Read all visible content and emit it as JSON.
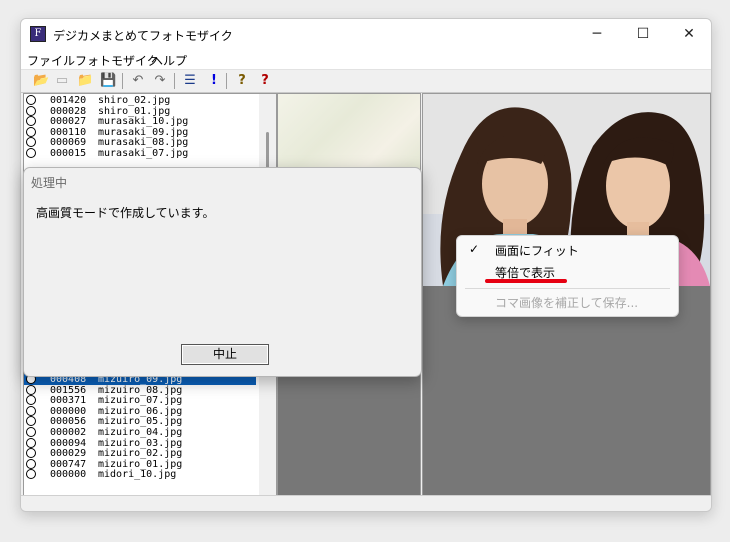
{
  "window": {
    "title": "デジカメまとめてフォトモザイク",
    "icon_letter": "F",
    "controls": {
      "minimize": "─",
      "maximize": "☐",
      "close": "✕"
    }
  },
  "menubar": [
    "ファイル",
    "フォトモザイク",
    "ヘルプ"
  ],
  "toolbar": {
    "icons": [
      "open-folder-icon",
      "disabled-folder-icon",
      "folder-icon",
      "save-icon",
      "undo-icon",
      "redo-icon",
      "list-icon",
      "exclamation-icon",
      "help-icon",
      "help-red-icon"
    ],
    "glyphs": [
      "📂",
      "▭",
      "📁",
      "💾",
      "↶",
      "↷",
      "☰",
      "!",
      "?",
      "?"
    ]
  },
  "file_list": {
    "top_rows": [
      {
        "num": "001420",
        "name": "shiro_02.jpg"
      },
      {
        "num": "000028",
        "name": "shiro_01.jpg"
      },
      {
        "num": "000027",
        "name": "murasaki_10.jpg"
      },
      {
        "num": "000110",
        "name": "murasaki_09.jpg"
      },
      {
        "num": "000069",
        "name": "murasaki_08.jpg"
      },
      {
        "num": "000015",
        "name": "murasaki_07.jpg"
      }
    ],
    "selected_row": {
      "num": "000408",
      "name": "mizuiro_09.jpg"
    },
    "bottom_rows": [
      {
        "num": "001556",
        "name": "mizuiro_08.jpg"
      },
      {
        "num": "000371",
        "name": "mizuiro_07.jpg"
      },
      {
        "num": "000000",
        "name": "mizuiro_06.jpg"
      },
      {
        "num": "000056",
        "name": "mizuiro_05.jpg"
      },
      {
        "num": "000002",
        "name": "mizuiro_04.jpg"
      },
      {
        "num": "000094",
        "name": "mizuiro_03.jpg"
      },
      {
        "num": "000029",
        "name": "mizuiro_02.jpg"
      },
      {
        "num": "000747",
        "name": "mizuiro_01.jpg"
      },
      {
        "num": "000000",
        "name": "midori_10.jpg"
      }
    ]
  },
  "dialog": {
    "title": "処理中",
    "message": "高画質モードで作成しています。",
    "cancel_label": "中止"
  },
  "context_menu": {
    "check_glyph": "✓",
    "items": [
      {
        "label": "画面にフィット",
        "checked": true,
        "enabled": true
      },
      {
        "label": "等倍で表示",
        "checked": false,
        "enabled": true
      },
      {
        "label": "コマ画像を補正して保存...",
        "checked": false,
        "enabled": false
      }
    ],
    "highlight_color": "#e60012"
  },
  "colors": {
    "selection": "#0a5fb8",
    "pane_gray": "#777777"
  }
}
